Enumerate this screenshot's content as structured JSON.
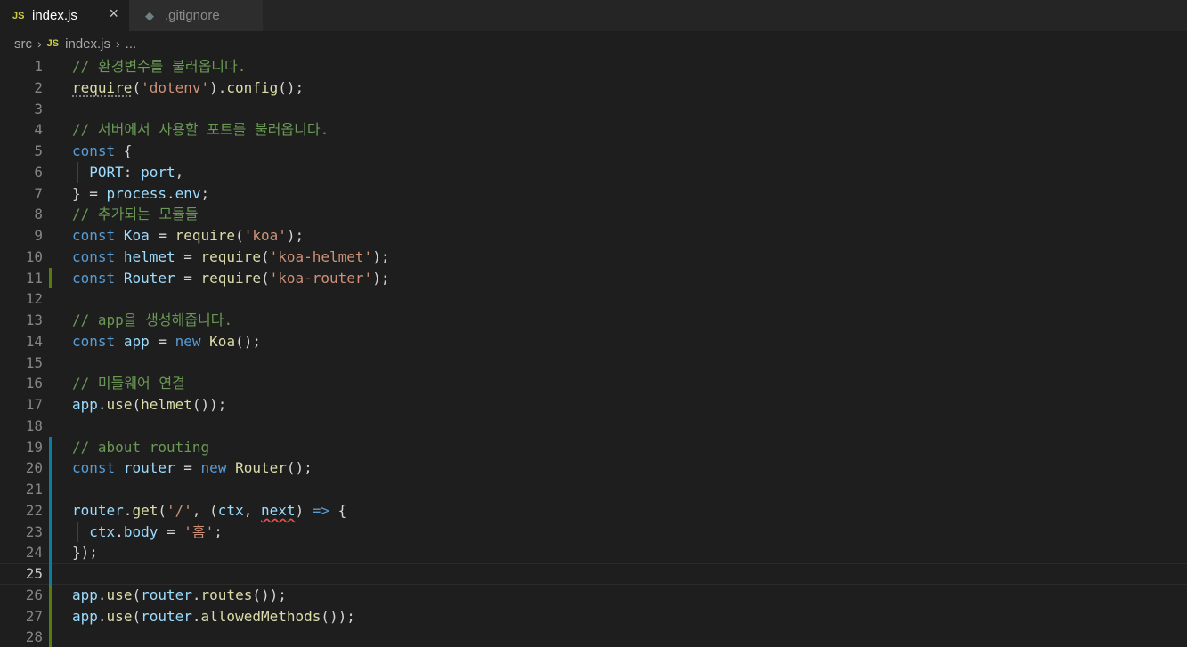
{
  "tabs": [
    {
      "badge": "JS",
      "label": "index.js",
      "close": "×"
    },
    {
      "icon": "diamond",
      "label": ".gitignore"
    }
  ],
  "breadcrumb": {
    "folder": "src",
    "chevron": "›",
    "badge": "JS",
    "file": "index.js",
    "tail": "..."
  },
  "editor": {
    "lines": [
      {
        "n": "1",
        "marker": "",
        "indent": false,
        "tokens": [
          {
            "t": "comment",
            "v": "// 환경변수를 불러옵니다."
          }
        ]
      },
      {
        "n": "2",
        "marker": "",
        "indent": false,
        "tokens": [
          {
            "t": "func",
            "v": "require",
            "hint": true
          },
          {
            "t": "punct",
            "v": "("
          },
          {
            "t": "string",
            "v": "'dotenv'"
          },
          {
            "t": "punct",
            "v": ")."
          },
          {
            "t": "func",
            "v": "config"
          },
          {
            "t": "punct",
            "v": "();"
          }
        ]
      },
      {
        "n": "3",
        "marker": "",
        "indent": false,
        "tokens": []
      },
      {
        "n": "4",
        "marker": "",
        "indent": false,
        "tokens": [
          {
            "t": "comment",
            "v": "// 서버에서 사용할 포트를 불러옵니다."
          }
        ]
      },
      {
        "n": "5",
        "marker": "",
        "indent": false,
        "tokens": [
          {
            "t": "keyword",
            "v": "const"
          },
          {
            "t": "punct",
            "v": " {"
          }
        ]
      },
      {
        "n": "6",
        "marker": "",
        "indent": true,
        "tokens": [
          {
            "t": "punct",
            "v": "  "
          },
          {
            "t": "var",
            "v": "PORT"
          },
          {
            "t": "punct",
            "v": ": "
          },
          {
            "t": "var",
            "v": "port"
          },
          {
            "t": "punct",
            "v": ","
          }
        ]
      },
      {
        "n": "7",
        "marker": "",
        "indent": false,
        "tokens": [
          {
            "t": "punct",
            "v": "} = "
          },
          {
            "t": "var",
            "v": "process"
          },
          {
            "t": "punct",
            "v": "."
          },
          {
            "t": "var",
            "v": "env"
          },
          {
            "t": "punct",
            "v": ";"
          }
        ]
      },
      {
        "n": "8",
        "marker": "",
        "indent": false,
        "tokens": [
          {
            "t": "comment",
            "v": "// 추가되는 모듈들"
          }
        ]
      },
      {
        "n": "9",
        "marker": "",
        "indent": false,
        "tokens": [
          {
            "t": "keyword",
            "v": "const"
          },
          {
            "t": "punct",
            "v": " "
          },
          {
            "t": "var",
            "v": "Koa"
          },
          {
            "t": "punct",
            "v": " = "
          },
          {
            "t": "func",
            "v": "require"
          },
          {
            "t": "punct",
            "v": "("
          },
          {
            "t": "string",
            "v": "'koa'"
          },
          {
            "t": "punct",
            "v": ");"
          }
        ]
      },
      {
        "n": "10",
        "marker": "",
        "indent": false,
        "tokens": [
          {
            "t": "keyword",
            "v": "const"
          },
          {
            "t": "punct",
            "v": " "
          },
          {
            "t": "var",
            "v": "helmet"
          },
          {
            "t": "punct",
            "v": " = "
          },
          {
            "t": "func",
            "v": "require"
          },
          {
            "t": "punct",
            "v": "("
          },
          {
            "t": "string",
            "v": "'koa-helmet'"
          },
          {
            "t": "punct",
            "v": ");"
          }
        ]
      },
      {
        "n": "11",
        "marker": "modified",
        "indent": false,
        "tokens": [
          {
            "t": "keyword",
            "v": "const"
          },
          {
            "t": "punct",
            "v": " "
          },
          {
            "t": "var",
            "v": "Router"
          },
          {
            "t": "punct",
            "v": " = "
          },
          {
            "t": "func",
            "v": "require"
          },
          {
            "t": "punct",
            "v": "("
          },
          {
            "t": "string",
            "v": "'koa-router'"
          },
          {
            "t": "punct",
            "v": ");"
          }
        ]
      },
      {
        "n": "12",
        "marker": "",
        "indent": false,
        "tokens": []
      },
      {
        "n": "13",
        "marker": "",
        "indent": false,
        "tokens": [
          {
            "t": "comment",
            "v": "// app을 생성해줍니다."
          }
        ]
      },
      {
        "n": "14",
        "marker": "",
        "indent": false,
        "tokens": [
          {
            "t": "keyword",
            "v": "const"
          },
          {
            "t": "punct",
            "v": " "
          },
          {
            "t": "var",
            "v": "app"
          },
          {
            "t": "punct",
            "v": " = "
          },
          {
            "t": "keyword",
            "v": "new"
          },
          {
            "t": "punct",
            "v": " "
          },
          {
            "t": "func",
            "v": "Koa"
          },
          {
            "t": "punct",
            "v": "();"
          }
        ]
      },
      {
        "n": "15",
        "marker": "",
        "indent": false,
        "tokens": []
      },
      {
        "n": "16",
        "marker": "",
        "indent": false,
        "tokens": [
          {
            "t": "comment",
            "v": "// 미들웨어 연결"
          }
        ]
      },
      {
        "n": "17",
        "marker": "",
        "indent": false,
        "tokens": [
          {
            "t": "var",
            "v": "app"
          },
          {
            "t": "punct",
            "v": "."
          },
          {
            "t": "func",
            "v": "use"
          },
          {
            "t": "punct",
            "v": "("
          },
          {
            "t": "func",
            "v": "helmet"
          },
          {
            "t": "punct",
            "v": "());"
          }
        ]
      },
      {
        "n": "18",
        "marker": "",
        "indent": false,
        "tokens": []
      },
      {
        "n": "19",
        "marker": "added",
        "indent": false,
        "tokens": [
          {
            "t": "comment",
            "v": "// about routing"
          }
        ]
      },
      {
        "n": "20",
        "marker": "added",
        "indent": false,
        "tokens": [
          {
            "t": "keyword",
            "v": "const"
          },
          {
            "t": "punct",
            "v": " "
          },
          {
            "t": "var",
            "v": "router"
          },
          {
            "t": "punct",
            "v": " = "
          },
          {
            "t": "keyword",
            "v": "new"
          },
          {
            "t": "punct",
            "v": " "
          },
          {
            "t": "func",
            "v": "Router"
          },
          {
            "t": "punct",
            "v": "();"
          }
        ]
      },
      {
        "n": "21",
        "marker": "added",
        "indent": false,
        "tokens": []
      },
      {
        "n": "22",
        "marker": "added",
        "indent": false,
        "tokens": [
          {
            "t": "var",
            "v": "router"
          },
          {
            "t": "punct",
            "v": "."
          },
          {
            "t": "func",
            "v": "get"
          },
          {
            "t": "punct",
            "v": "("
          },
          {
            "t": "string",
            "v": "'/'"
          },
          {
            "t": "punct",
            "v": ", ("
          },
          {
            "t": "var",
            "v": "ctx"
          },
          {
            "t": "punct",
            "v": ", "
          },
          {
            "t": "var",
            "v": "next",
            "squiggle": true
          },
          {
            "t": "punct",
            "v": ") "
          },
          {
            "t": "keyword",
            "v": "=>"
          },
          {
            "t": "punct",
            "v": " {"
          }
        ]
      },
      {
        "n": "23",
        "marker": "added",
        "indent": true,
        "tokens": [
          {
            "t": "punct",
            "v": "  "
          },
          {
            "t": "var",
            "v": "ctx"
          },
          {
            "t": "punct",
            "v": "."
          },
          {
            "t": "var",
            "v": "body"
          },
          {
            "t": "punct",
            "v": " = "
          },
          {
            "t": "string",
            "v": "'홈'"
          },
          {
            "t": "punct",
            "v": ";"
          }
        ]
      },
      {
        "n": "24",
        "marker": "added",
        "indent": false,
        "tokens": [
          {
            "t": "punct",
            "v": "});"
          }
        ]
      },
      {
        "n": "25",
        "marker": "added",
        "indent": false,
        "current": true,
        "tokens": []
      },
      {
        "n": "26",
        "marker": "modified",
        "indent": false,
        "tokens": [
          {
            "t": "var",
            "v": "app"
          },
          {
            "t": "punct",
            "v": "."
          },
          {
            "t": "func",
            "v": "use"
          },
          {
            "t": "punct",
            "v": "("
          },
          {
            "t": "var",
            "v": "router"
          },
          {
            "t": "punct",
            "v": "."
          },
          {
            "t": "func",
            "v": "routes"
          },
          {
            "t": "punct",
            "v": "());"
          }
        ]
      },
      {
        "n": "27",
        "marker": "modified",
        "indent": false,
        "tokens": [
          {
            "t": "var",
            "v": "app"
          },
          {
            "t": "punct",
            "v": "."
          },
          {
            "t": "func",
            "v": "use"
          },
          {
            "t": "punct",
            "v": "("
          },
          {
            "t": "var",
            "v": "router"
          },
          {
            "t": "punct",
            "v": "."
          },
          {
            "t": "func",
            "v": "allowedMethods"
          },
          {
            "t": "punct",
            "v": "());"
          }
        ]
      },
      {
        "n": "28",
        "marker": "modified",
        "indent": false,
        "tokens": []
      }
    ]
  }
}
